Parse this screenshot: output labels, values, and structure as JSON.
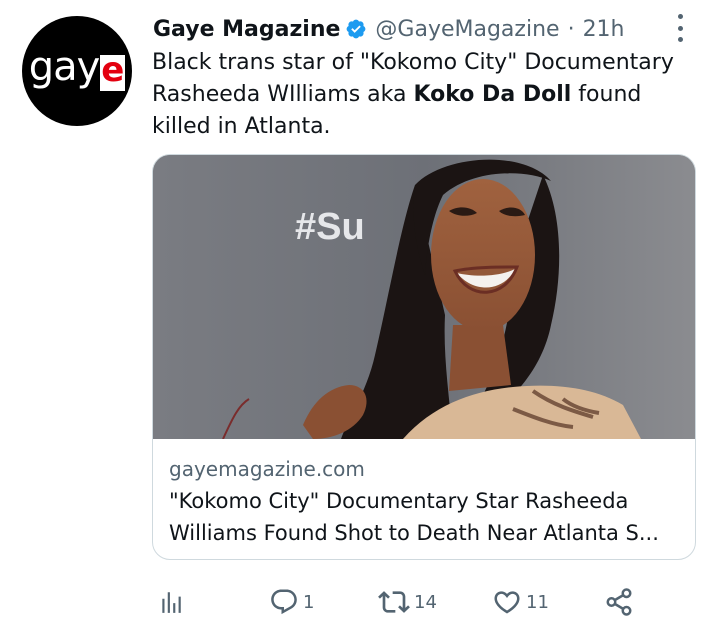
{
  "account": {
    "name": "Gaye Magazine",
    "handle": "@GayeMagazine",
    "time": "21h",
    "avatar_logo_text": "gaye"
  },
  "tweet": {
    "text_part1": "Black trans star of \"Kokomo City\" Documentary Rasheeda WIlliams aka ",
    "text_bold": "Koko Da Doll",
    "text_part2": " found killed in Atlanta."
  },
  "card": {
    "image_sign_text": "#Su",
    "domain": "gayemagazine.com",
    "title": "\"Kokomo City\" Documentary Star Rasheeda Williams Found Shot to Death Near Atlanta S..."
  },
  "actions": {
    "replies": "1",
    "retweets": "14",
    "likes": "11"
  },
  "icons": {
    "verified": "verified-badge-icon",
    "more": "more-options-icon",
    "analytics": "analytics-icon",
    "reply": "reply-icon",
    "retweet": "retweet-icon",
    "like": "like-icon",
    "share": "share-icon"
  },
  "colors": {
    "verified_blue": "#1d9bf0",
    "secondary_text": "#536471",
    "primary_text": "#0f1419",
    "logo_red": "#e3000f"
  }
}
